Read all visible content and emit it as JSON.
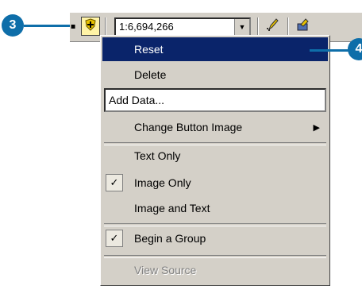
{
  "colors": {
    "callout": "#0e6ea9",
    "highlight": "#0a246a",
    "menu_bg": "#d4d0c8"
  },
  "callouts": {
    "left": "3",
    "right": "4"
  },
  "toolbar": {
    "add_data_icon": "plus-shield-icon",
    "scale_value": "1:6,694,266",
    "edit_icon": "pencil-icon",
    "tool_icon": "editor-toolbar-icon"
  },
  "menu": {
    "items": [
      {
        "label": "Reset",
        "state": "highlighted"
      },
      {
        "label": "Delete"
      },
      {
        "label": "Add Data...",
        "type": "edit"
      },
      {
        "label": "Change Button Image",
        "submenu": true
      },
      {
        "label": "Text Only"
      },
      {
        "label": "Image Only",
        "checked": true
      },
      {
        "label": "Image and Text"
      },
      {
        "label": "Begin a Group",
        "checked": true
      },
      {
        "label": "View Source",
        "state": "disabled"
      }
    ]
  }
}
